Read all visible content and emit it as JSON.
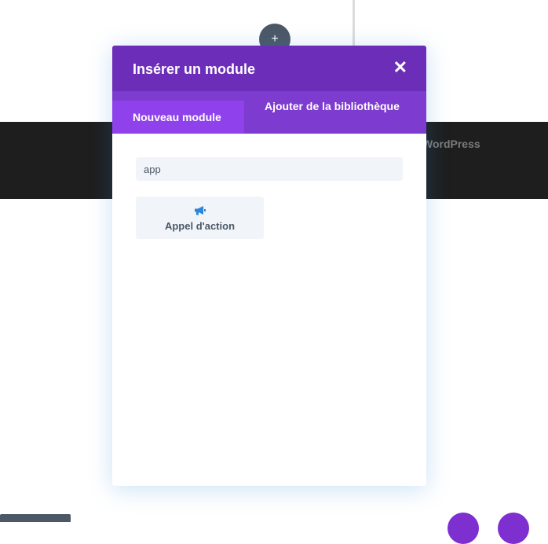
{
  "background": {
    "add_icon_glyph": "+",
    "footer_text": "WordPress"
  },
  "modal": {
    "title": "Insérer un module",
    "close_glyph": "✕",
    "tabs": [
      {
        "label": "Nouveau module",
        "active": true
      },
      {
        "label": "Ajouter de la bibliothèque",
        "active": false
      }
    ],
    "search": {
      "value": "app"
    },
    "modules": [
      {
        "label": "Appel d'action",
        "icon": "megaphone-icon"
      }
    ]
  },
  "colors": {
    "header": "#6c2eb9",
    "tabs_bar": "#7d3bcf",
    "tab_active": "#8f42ec",
    "icon_blue": "#2b87da"
  }
}
